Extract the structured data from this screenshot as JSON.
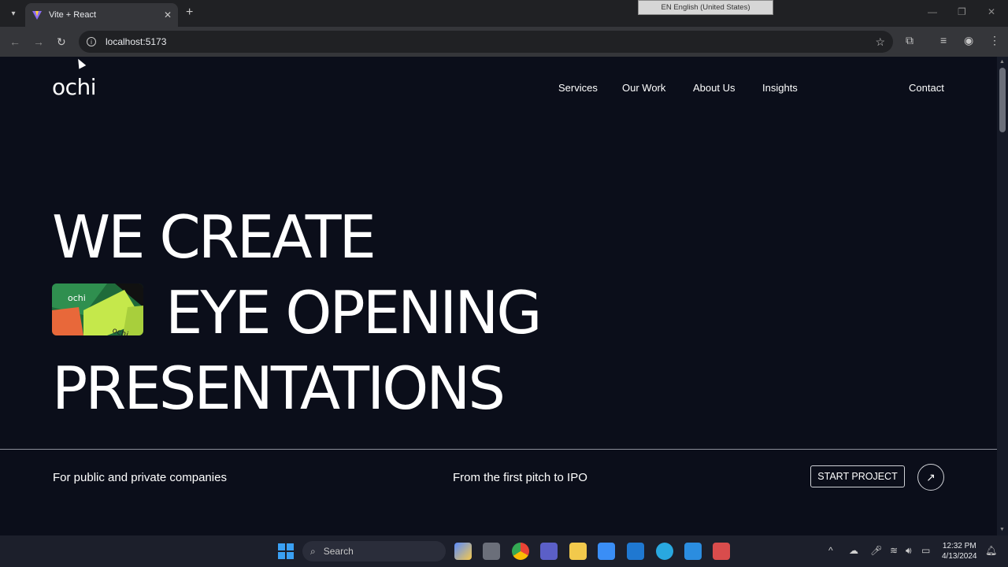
{
  "browser": {
    "tab_title": "Vite + React",
    "url": "localhost:5173",
    "language_bar": "EN English (United States)"
  },
  "site": {
    "logo": "ochi",
    "nav": [
      "Services",
      "Our Work",
      "About Us",
      "Insights"
    ],
    "contact": "Contact",
    "headline": {
      "line1": "WE CREATE",
      "line2": "EYE OPENING",
      "line3": "PRESENTATIONS"
    },
    "thumbnail_label_top": "ochi",
    "thumbnail_label_bottom": "ochi",
    "sub_left": "For public and private companies",
    "sub_mid": "From the first pitch to IPO",
    "cta": "START PROJECT"
  },
  "taskbar": {
    "search_placeholder": "Search",
    "time": "12:32 PM",
    "date": "4/13/2024"
  },
  "colors": {
    "page_bg": "#0b0e1a",
    "thumb_green": "#c5e84b",
    "thumb_orange": "#e8683a"
  }
}
